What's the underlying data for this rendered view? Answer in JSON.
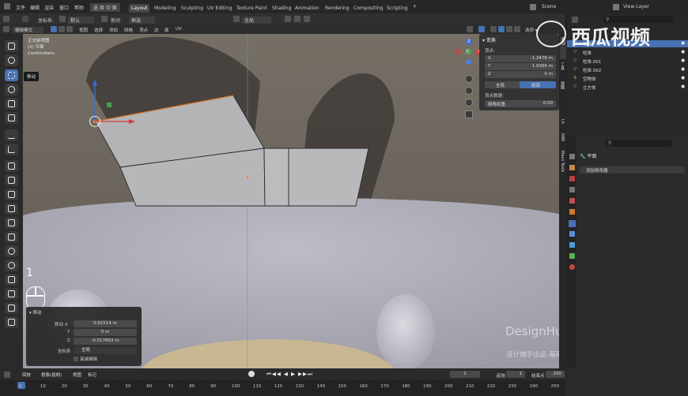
{
  "menubar": {
    "items": [
      "文件",
      "编辑",
      "渲染",
      "窗口",
      "帮助"
    ],
    "left_label": "选 择 切 换",
    "workspaces": [
      "Layout",
      "Modeling",
      "Sculpting",
      "UV Editing",
      "Texture Paint",
      "Shading",
      "Animation",
      "Rendering",
      "Compositing",
      "Scripting"
    ],
    "active_workspace": "Layout",
    "plus": "+",
    "scene": "Scene",
    "view_layer": "View Layer"
  },
  "header": {
    "coord_label": "坐标系:",
    "coord_value": "默认",
    "drag_label": "拖动",
    "drag_value": "框选",
    "global": "全局",
    "mode": "编辑模式",
    "menus": [
      "视图",
      "选择",
      "添加",
      "网格",
      "顶点",
      "边",
      "面",
      "UV"
    ],
    "options": "选项 ▾"
  },
  "viewport": {
    "view_name": "正交前视图",
    "object_line": "(1) 平面",
    "units": "Centimeters",
    "tooltip": "移动",
    "gizmo": {
      "x": "X",
      "y": "Y",
      "z": "Z"
    }
  },
  "transform_panel": {
    "title": "变换",
    "vertex_label": "顶点:",
    "x_label": "X",
    "x_value": "-1.2478 m",
    "y_label": "Y",
    "y_value": "1.9366 m",
    "z_label": "Z",
    "z_value": "0 m",
    "global_btn": "全局",
    "local_btn": "局部",
    "data_label": "顶点数据:",
    "bevel_label": "倒角权重",
    "bevel_value": "0.00"
  },
  "side_tabs": [
    "条目",
    "工具",
    "视图",
    "LS",
    "Maxv Tools",
    "RBR"
  ],
  "outliner": {
    "search_placeholder": "",
    "items": [
      {
        "name": "平面",
        "selected": true
      },
      {
        "name": "柱体",
        "selected": false
      },
      {
        "name": "柱体.001",
        "selected": false
      },
      {
        "name": "柱体.002",
        "selected": false
      },
      {
        "name": "空物体",
        "selected": false
      },
      {
        "name": "立方体",
        "selected": false
      }
    ]
  },
  "properties": {
    "object_name": "平面",
    "add_modifier": "添加修改器"
  },
  "redo_panel": {
    "title": "移动",
    "x_label": "移动 X",
    "x_value": "0.01514 m",
    "y_label": "Y",
    "y_value": "0 m",
    "z_label": "Z",
    "z_value": "-0.017663 m",
    "orient_label": "坐标系",
    "orient_value": "全局",
    "proportional_label": "衰减编辑"
  },
  "overlay_number": "1",
  "timeline": {
    "menus": [
      "回放",
      "抠像(插帧)",
      "视图",
      "标记"
    ],
    "current_frame": "1",
    "start_label": "起始",
    "start_value": "1",
    "end_label": "结束点",
    "end_value": "250",
    "ticks": [
      "0",
      "10",
      "20",
      "30",
      "40",
      "50",
      "60",
      "70",
      "80",
      "90",
      "100",
      "110",
      "120",
      "130",
      "140",
      "150",
      "160",
      "170",
      "180",
      "190",
      "200",
      "210",
      "220",
      "230",
      "240",
      "250"
    ]
  },
  "watermarks": {
    "brand": "西瓜视频",
    "design": "DesignHunting",
    "sub": "设计捕手出品-基础部分"
  },
  "colors": {
    "accent": "#4772b3",
    "active_ws": "#474747",
    "panel": "#333333"
  }
}
